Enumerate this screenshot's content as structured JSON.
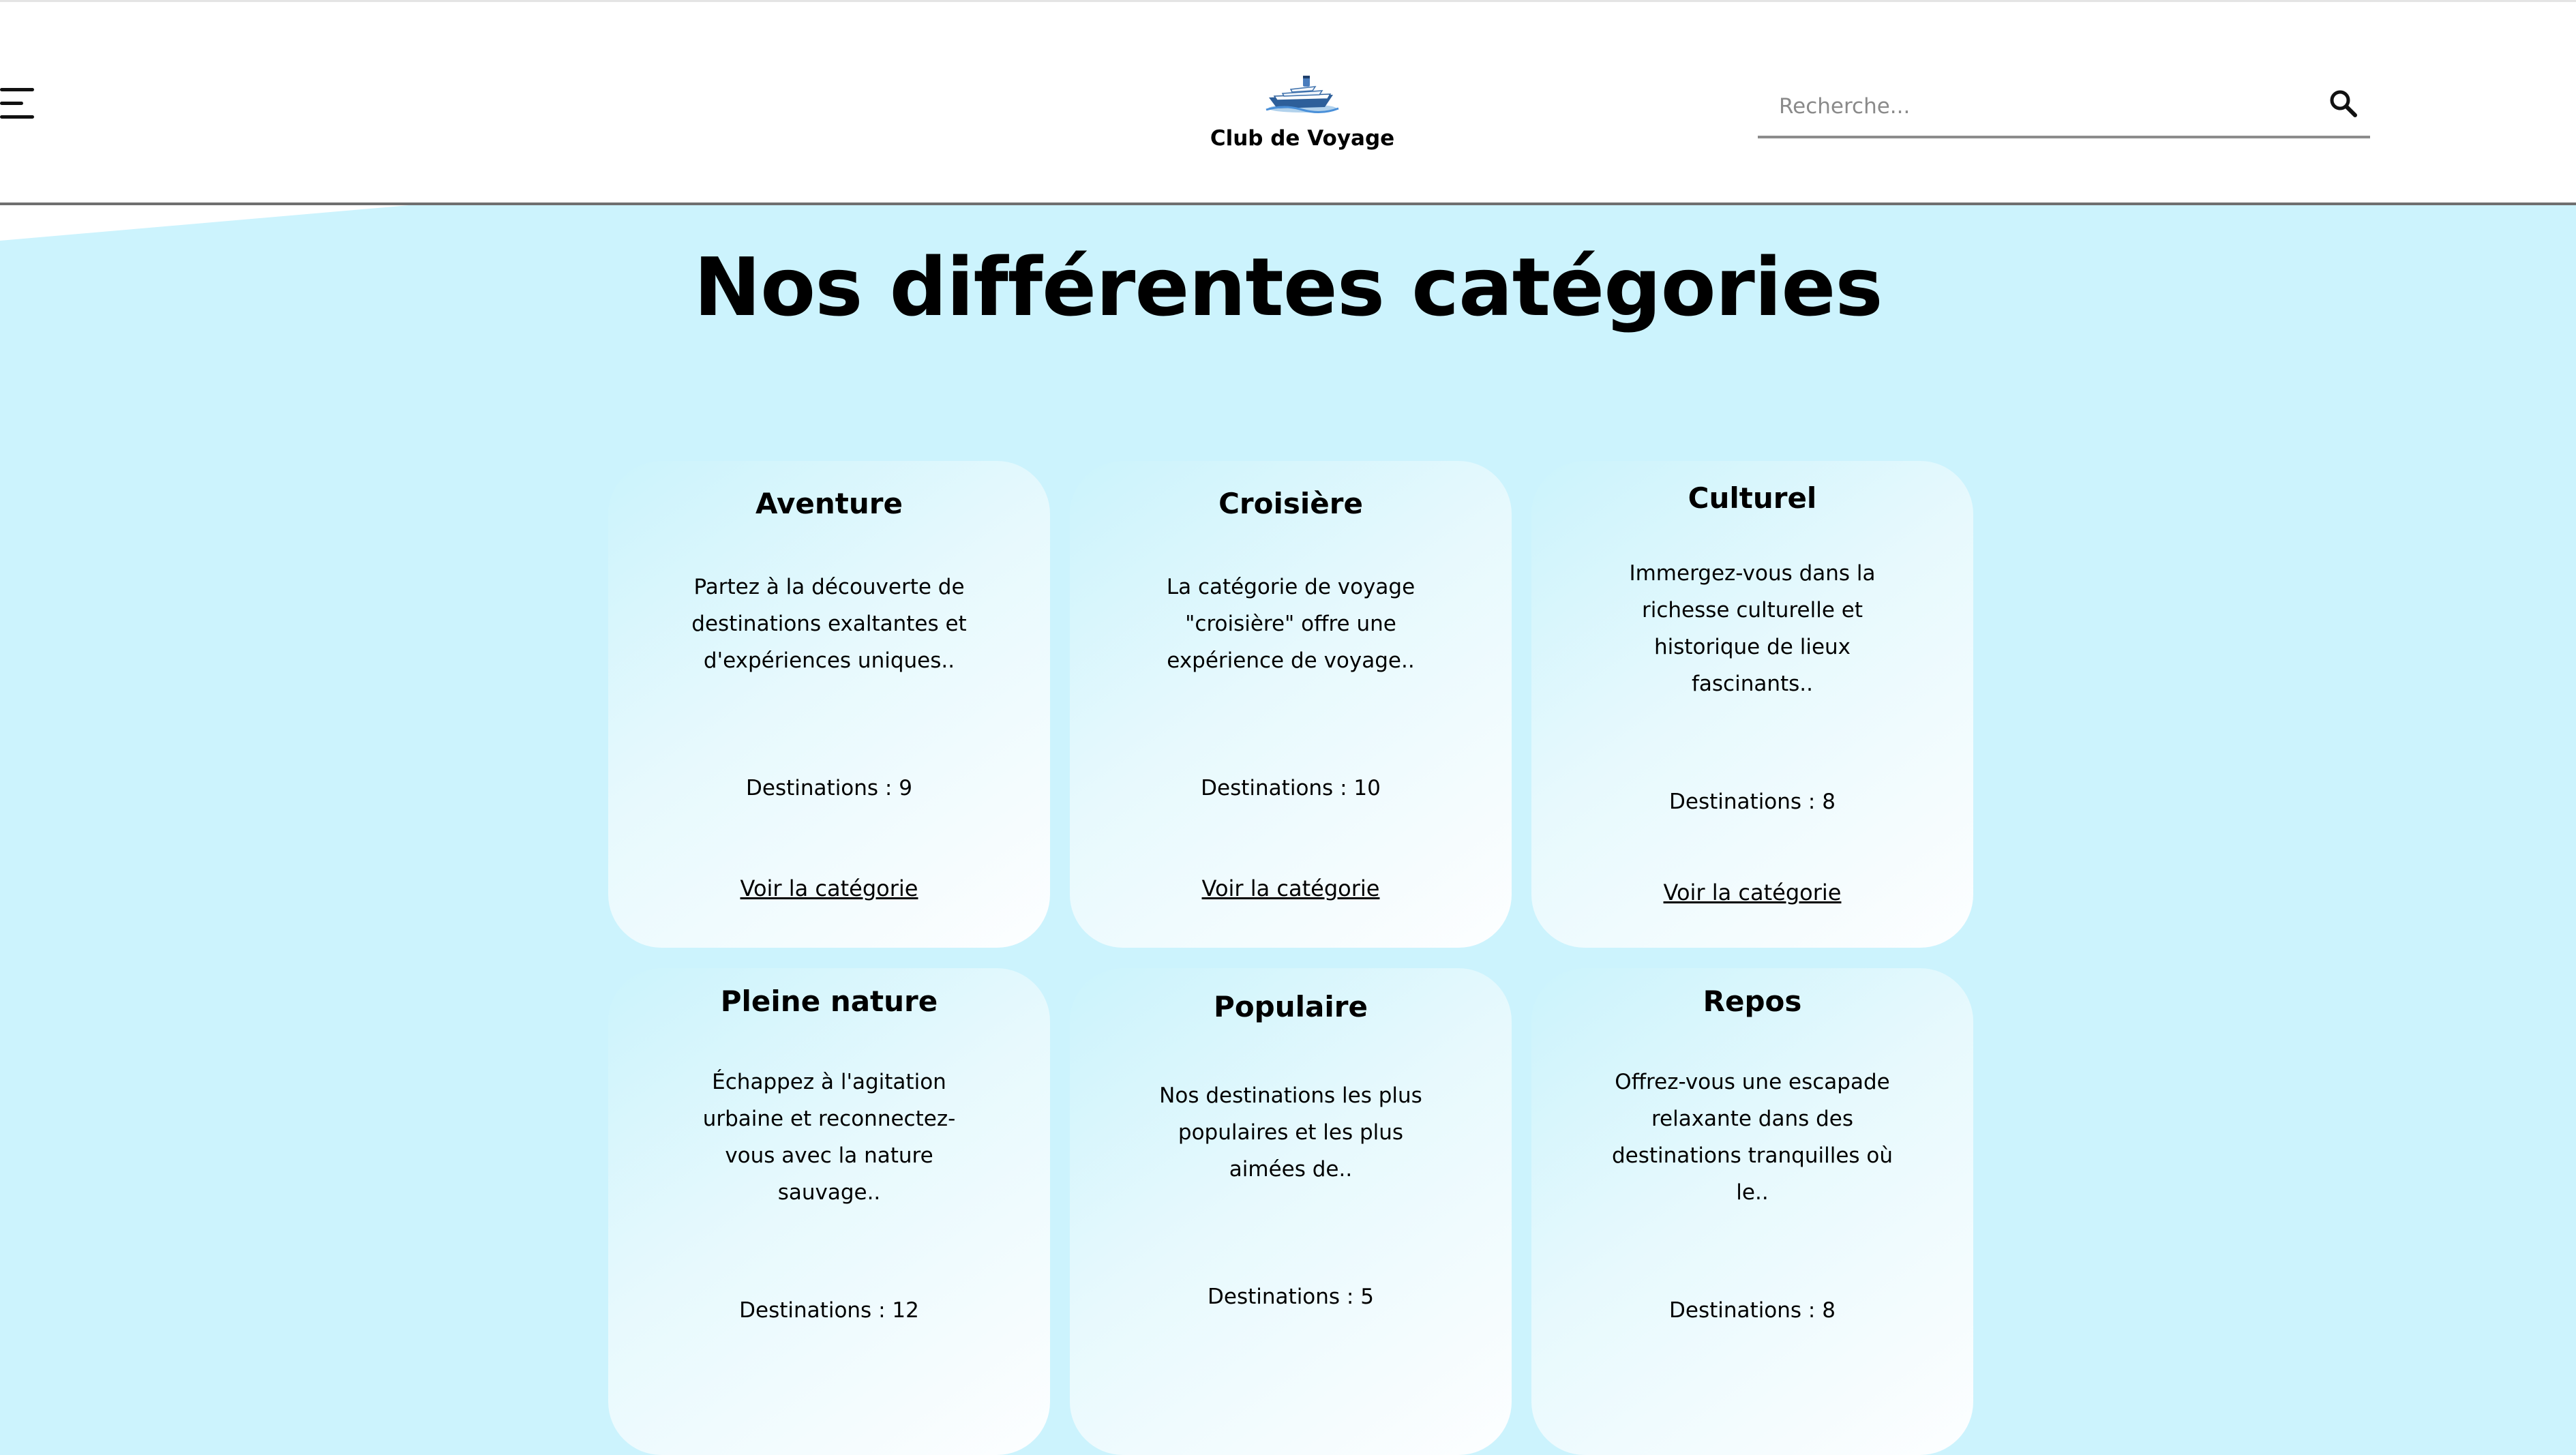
{
  "header": {
    "brand": "Club de Voyage",
    "search_placeholder": "Recherche..."
  },
  "page_title": "Nos différentes catégories",
  "categories": [
    {
      "title": "Aventure",
      "description": "Partez à la découverte de destinations exaltantes et d'expériences uniques..",
      "destinations": "Destinations : 9",
      "link": "Voir la catégorie"
    },
    {
      "title": "Croisière",
      "description": "La catégorie de voyage \"croisière\" offre une expérience de voyage..",
      "destinations": "Destinations : 10",
      "link": "Voir la catégorie"
    },
    {
      "title": "Culturel",
      "description": "Immergez-vous dans la richesse culturelle et historique de lieux fascinants..",
      "destinations": "Destinations : 8",
      "link": "Voir la catégorie"
    },
    {
      "title": "Pleine nature",
      "description": "Échappez à l'agitation urbaine et reconnectez-vous avec la nature sauvage..",
      "destinations": "Destinations : 12"
    },
    {
      "title": "Populaire",
      "description": "Nos destinations les plus populaires et les plus aimées de..",
      "destinations": "Destinations : 5"
    },
    {
      "title": "Repos",
      "description": "Offrez-vous une escapade relaxante dans des destinations tranquilles où le..",
      "destinations": "Destinations : 8"
    }
  ],
  "icons": {
    "menu": "hamburger-menu-icon",
    "logo": "cruise-ship-logo",
    "search": "search-icon"
  }
}
